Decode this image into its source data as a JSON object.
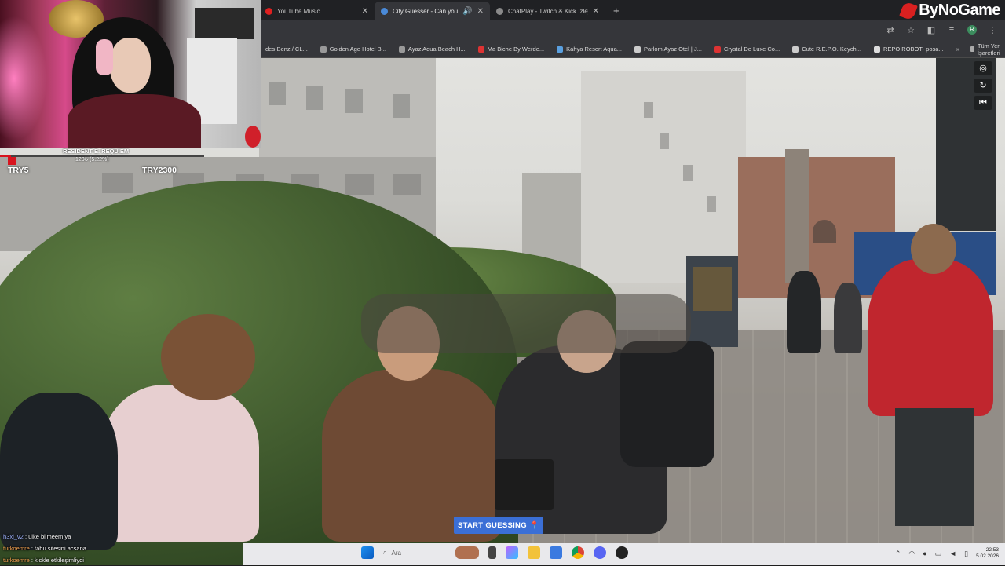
{
  "browser": {
    "tabs": [
      {
        "title": "YouTube Music",
        "active": false
      },
      {
        "title": "City Guesser - Can you gue",
        "active": true
      },
      {
        "title": "ChatPlay - Twitch & Kick İzleyic",
        "active": false
      }
    ],
    "new_tab": "+",
    "bookmarks": [
      "des-Benz / CL...",
      "Golden Age Hotel B...",
      "Ayaz Aqua Beach H...",
      "Ma Biche By Werde...",
      "Kahya Resort Aqua...",
      "Parlom Ayaz Otel | J...",
      "Crystal De Luxe Co...",
      "Cute R.E.P.O. Keych...",
      "REPO ROBOT- posa..."
    ],
    "bookmarks_more": "»",
    "all_bookmarks": "Tüm Yer İşaretleri",
    "profile_initial": "R"
  },
  "brand": {
    "name": "ByNoGame"
  },
  "game": {
    "start_button": "START GUESSING",
    "controls": [
      "target-icon",
      "rotate-icon",
      "rewind-icon"
    ]
  },
  "widget": {
    "title": "RESIDENT E. REQUIEM",
    "progress_text": "120₺ (5.22%)",
    "progress_percent": 5.22,
    "left_label": "TRY5",
    "right_label": "TRY2300",
    "accent": "#d8141e"
  },
  "chat": [
    {
      "user": "h3xi_v2",
      "message": "ülke bilmeem ya"
    },
    {
      "user": "turkoemre",
      "message": "tabu sitesini acsana"
    },
    {
      "user": "turkoemre",
      "message": "kickle etkileşimliydi"
    }
  ],
  "taskbar": {
    "search_placeholder": "Ara",
    "time": "22:53",
    "date": "5.02.2026"
  }
}
